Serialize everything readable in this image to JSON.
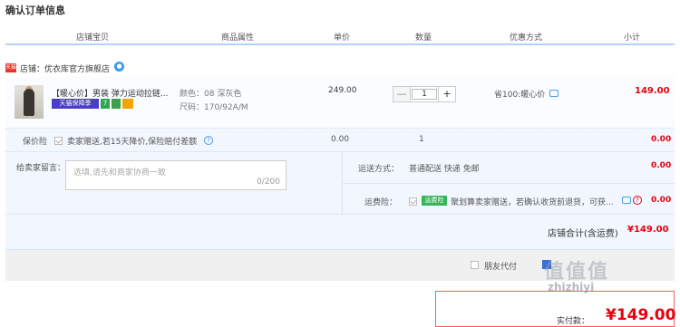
{
  "page_title": "确认订单信息",
  "columns": [
    "店铺宝贝",
    "商品属性",
    "单价",
    "数量",
    "优惠方式",
    "小计"
  ],
  "shop": {
    "badge": "天猫",
    "label": "店铺：优衣库官方旗舰店"
  },
  "product": {
    "title": "【暖心价】男装 弹力运动拉链...",
    "badges": [
      "天猫保障季",
      "7",
      "",
      ""
    ],
    "color_label": "颜色：08 深灰色",
    "size_label": "尺码：170/92A/M",
    "unit_price": "249.00",
    "quantity": "1",
    "minus": "—",
    "plus": "+",
    "discount": "省100:暖心价",
    "subtotal": "149.00"
  },
  "price_protect": {
    "label": "保价险",
    "desc": "卖家赠送,若15天降价,保险赔付差额",
    "price": "0.00",
    "qty": "1",
    "subtotal": "0.00"
  },
  "message": {
    "label": "给卖家留言：",
    "placeholder": "选填,请先和商家协商一致",
    "counter": "0/200"
  },
  "shipping": {
    "label": "运送方式：",
    "value": "普通配送 快递 免邮",
    "subtotal": "0.00"
  },
  "freight_insurance": {
    "label": "运费险：",
    "tag": "运费险",
    "desc": "聚划算卖家赠送，若确认收货前退货，可获...",
    "subtotal": "0.00"
  },
  "shop_total": {
    "label": "店铺合计(含运费)",
    "value": "¥149.00"
  },
  "friend_pay": {
    "label": "朋友代付"
  },
  "payment": {
    "label": "实付款：",
    "currency": "¥",
    "amount": "149.00"
  },
  "watermark": {
    "text": "值值值",
    "sub": "zhizhiyi"
  },
  "colors": {
    "accent_red": "#e8000c",
    "link_blue": "#4c9ee8",
    "panel_bg": "#f2f7ff"
  }
}
